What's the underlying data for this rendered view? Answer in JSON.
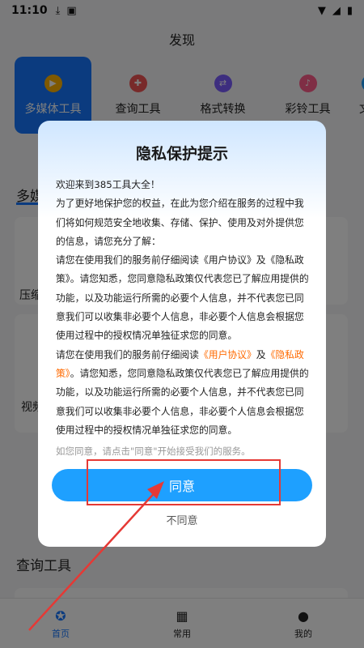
{
  "status_bar": {
    "time": "11:10"
  },
  "page": {
    "title": "发现"
  },
  "categories": [
    {
      "label": "多媒体工具",
      "icon": "media-icon",
      "color": "#ffb300"
    },
    {
      "label": "查询工具",
      "icon": "search-tool-icon",
      "color": "#f05454"
    },
    {
      "label": "格式转换",
      "icon": "convert-icon",
      "color": "#7b5cff"
    },
    {
      "label": "彩铃工具",
      "icon": "ringtone-icon",
      "color": "#ff5c8a"
    },
    {
      "label": "文字",
      "icon": "text-icon",
      "color": "#1ea0ff"
    }
  ],
  "sections": {
    "multimedia": "多媒",
    "query": "查询工具"
  },
  "background_cards": {
    "c1": "压缩",
    "c2": "视频"
  },
  "tabbar": {
    "home": "首页",
    "common": "常用",
    "mine": "我的"
  },
  "dialog": {
    "title": "隐私保护提示",
    "p1": "欢迎来到385工具大全！",
    "p2": "为了更好地保护您的权益，在此为您介绍在服务的过程中我们将如何规范安全地收集、存储、保护、使用及对外提供您的信息，请您充分了解：",
    "p3": "请您在使用我们的服务前仔细阅读《用户协议》及《隐私政策》。请您知悉，您同意隐私政策仅代表您已了解应用提供的功能，以及功能运行所需的必要个人信息，并不代表您已同意我们可以收集非必要个人信息，非必要个人信息会根据您使用过程中的授权情况单独征求您的同意。",
    "p4_a": "请您在使用我们的服务前仔细阅读",
    "p4_link1": "《用户协议》",
    "p4_b": "及",
    "p4_link2": "《隐私政策》",
    "p4_c": "。请您知悉，您同意隐私政策仅代表您已了解应用提供的功能，以及功能运行所需的必要个人信息，并不代表您已同意我们可以收集非必要个人信息，非必要个人信息会根据您使用过程中的授权情况单独征求您的同意。",
    "consent": "如您同意，请点击\"同意\"开始接受我们的服务。",
    "agree": "同意",
    "disagree": "不同意"
  },
  "colors": {
    "accent": "#1677ff",
    "button": "#1ea0ff",
    "link": "#ff6a00",
    "annotation": "#e53935"
  }
}
